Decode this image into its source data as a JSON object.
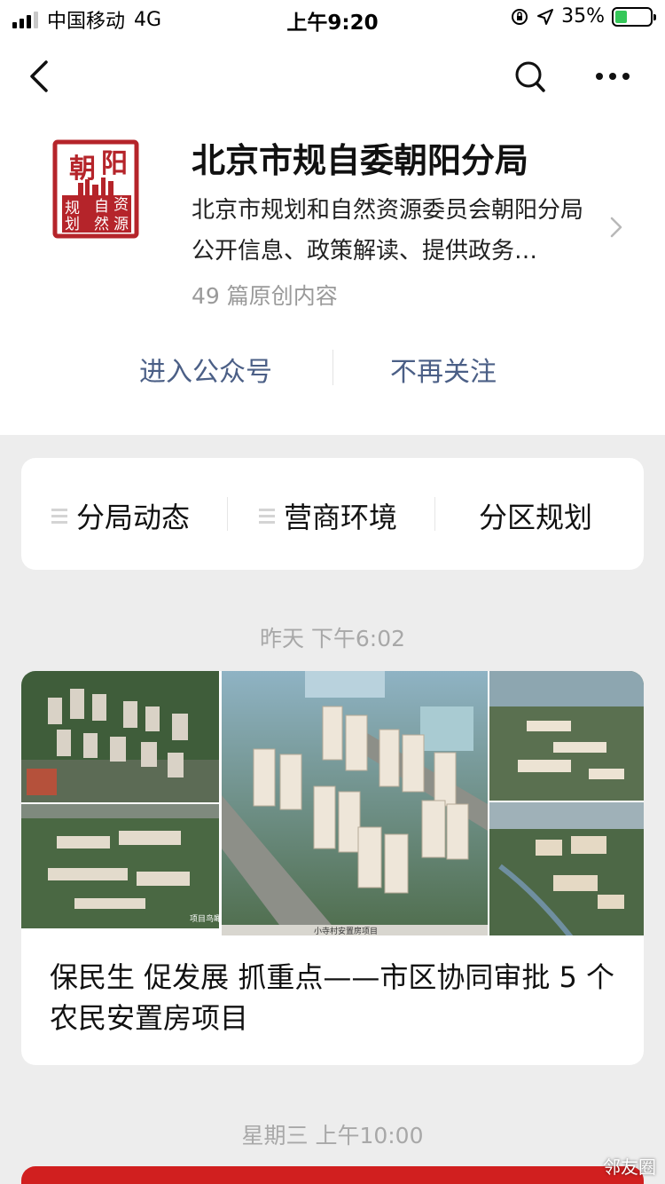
{
  "status_bar": {
    "carrier": "中国移动",
    "network": "4G",
    "time": "上午9:20",
    "battery": "35%",
    "battery_level": 0.35
  },
  "profile": {
    "logo_text": [
      "朝",
      "阳",
      "规",
      "划",
      "自",
      "然",
      "资",
      "源"
    ],
    "name": "北京市规自委朝阳分局",
    "description": "北京市规划和自然资源委员会朝阳分局公开信息、政策解读、提供政务…",
    "article_count": "49 篇原创内容",
    "enter_label": "进入公众号",
    "unfollow_label": "不再关注"
  },
  "menu": [
    {
      "label": "分局动态"
    },
    {
      "label": "营商环境"
    },
    {
      "label": "分区规划"
    }
  ],
  "feed": [
    {
      "timestamp": "昨天 下午6:02",
      "cover_caption": "小寺村安置房项目",
      "cover_caption_2": "项目鸟瞰图",
      "title": "保民生 促发展 抓重点——市区协同审批 5 个农民安置房项目"
    },
    {
      "timestamp": "星期三 上午10:00"
    }
  ],
  "watermark": "邻友圈",
  "colors": {
    "link": "#4b5f86",
    "background": "#ededed",
    "seal_red": "#b5242a"
  }
}
